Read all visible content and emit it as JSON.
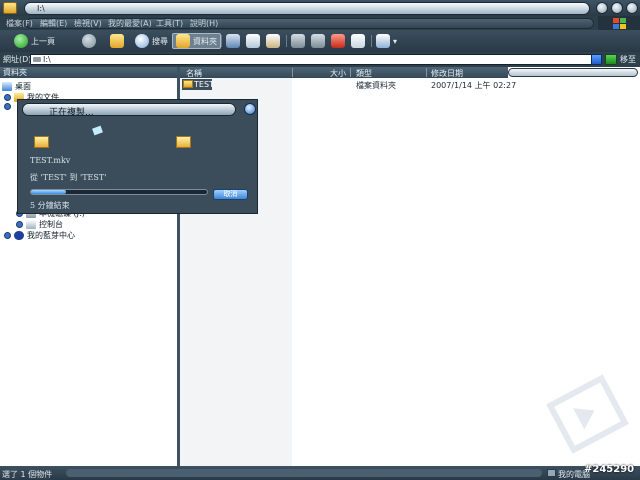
{
  "window": {
    "title": "I:\\"
  },
  "menu": {
    "items": [
      {
        "label": "檔案(F)"
      },
      {
        "label": "編輯(E)"
      },
      {
        "label": "檢視(V)"
      },
      {
        "label": "我的最愛(A)"
      },
      {
        "label": "工具(T)"
      },
      {
        "label": "說明(H)"
      }
    ]
  },
  "toolbar": {
    "back_label": "上一頁",
    "search_label": "搜尋",
    "folders_label": "資料夾"
  },
  "address": {
    "label": "網址(D)",
    "value": "I:\\",
    "go_label": "移至"
  },
  "left_pane": {
    "header": "資料夾",
    "tree": [
      {
        "label": "桌面"
      },
      {
        "label": "我的文件"
      },
      {
        "label": "本機磁碟 (J:)"
      },
      {
        "label": "控制台"
      },
      {
        "label": "我的藍芽中心"
      }
    ]
  },
  "file_list": {
    "columns": [
      {
        "label": "名稱"
      },
      {
        "label": "大小"
      },
      {
        "label": "類型"
      },
      {
        "label": "修改日期"
      }
    ],
    "rows": [
      {
        "name": "TEST",
        "size": "",
        "type": "檔案資料夾",
        "modified": "2007/1/14 上午 02:27"
      }
    ]
  },
  "dialog": {
    "title": "正在複製...",
    "file_name": "TEST.mkv",
    "from_to": "從 'TEST' 到 'TEST'",
    "time_remaining": "5 分鐘結束",
    "cancel_label": "取消",
    "progress": 0.2
  },
  "status": {
    "left": "選了 1 個物件",
    "right": "我的電腦"
  },
  "watermark": "#245290",
  "colors": {
    "chrome": "#3b4e5c",
    "accent": "#3c8dde",
    "selection": "#3b4e5c"
  }
}
